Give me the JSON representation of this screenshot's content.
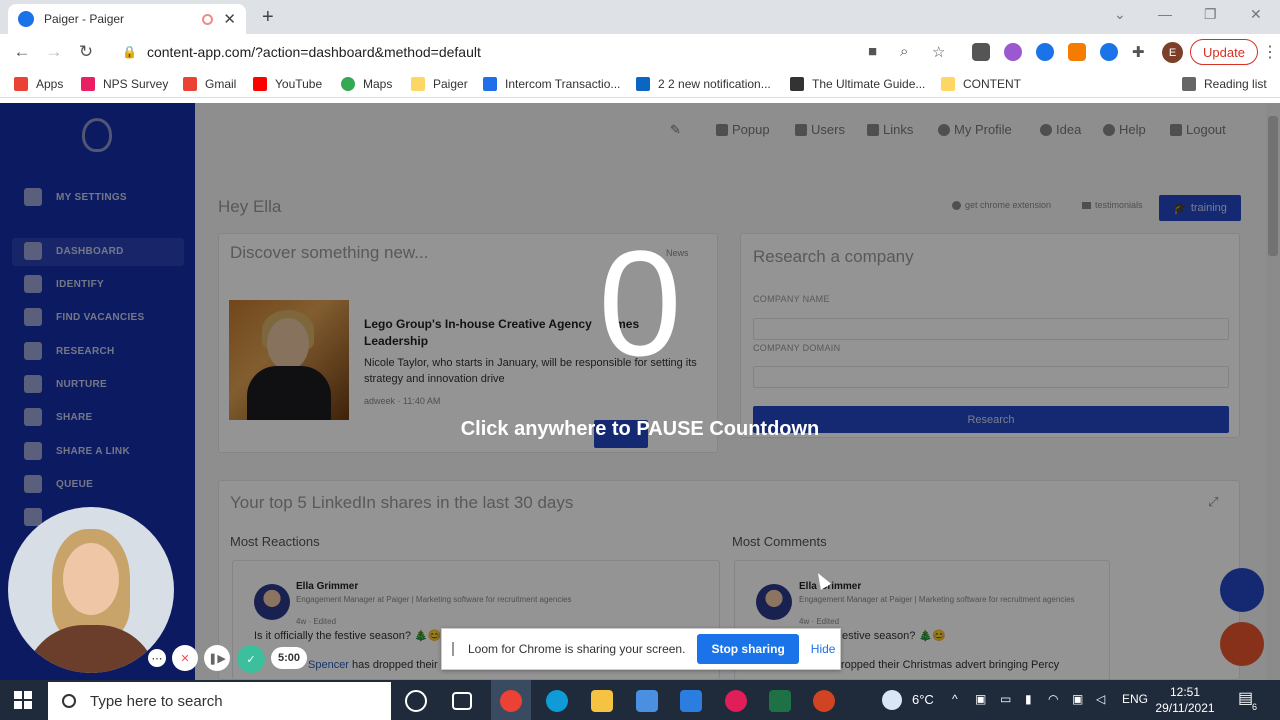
{
  "browser": {
    "tab_title": "Paiger - Paiger",
    "url": "content-app.com/?action=dashboard&method=default",
    "update_label": "Update",
    "profile_initial": "E",
    "reading_list": "Reading list"
  },
  "bookmarks": [
    {
      "label": "Apps",
      "color": "#ea4335"
    },
    {
      "label": "NPS Survey",
      "color": "#e91e63"
    },
    {
      "label": "Gmail",
      "color": "#ea4335"
    },
    {
      "label": "YouTube",
      "color": "#ff0000"
    },
    {
      "label": "Maps",
      "color": "#34a853"
    },
    {
      "label": "Paiger",
      "color": "#fdd663"
    },
    {
      "label": "Intercom Transactio...",
      "color": "#1f6feb"
    },
    {
      "label": "2 2 new notification...",
      "color": "#0a66c2"
    },
    {
      "label": "The Ultimate Guide...",
      "color": "#333333"
    },
    {
      "label": "CONTENT",
      "color": "#fdd663"
    }
  ],
  "sidebar": {
    "items": [
      {
        "label": "MY SETTINGS"
      },
      {
        "label": "DASHBOARD"
      },
      {
        "label": "IDENTIFY"
      },
      {
        "label": "FIND VACANCIES"
      },
      {
        "label": "RESEARCH"
      },
      {
        "label": "NURTURE"
      },
      {
        "label": "SHARE"
      },
      {
        "label": "SHARE A LINK"
      },
      {
        "label": "QUEUE"
      }
    ]
  },
  "topnav": [
    "Popup",
    "Users",
    "Links",
    "My Profile",
    "Idea",
    "Help",
    "Logout"
  ],
  "greeting": "Hey Ella",
  "header_links": {
    "extension": "get chrome extension",
    "testimonials": "testimonials",
    "training": "training"
  },
  "discover": {
    "title": "Discover something new...",
    "news_label": "News",
    "article_title": "Lego Group's In-house Creative Agency ...mes Leadership",
    "article_title_l1": "Lego Group's In-house Creative Agency",
    "article_title_l1b": "mes",
    "article_title_l2": "Leadership",
    "article_desc": "Nicole Taylor, who starts in January, will be responsible for setting its strategy and innovation drive",
    "source": "adweek",
    "time": "11:40 AM"
  },
  "research": {
    "title": "Research a company",
    "company_name_label": "COMPANY NAME",
    "company_domain_label": "COMPANY DOMAIN",
    "button": "Research"
  },
  "linkedin": {
    "title": "Your top 5 LinkedIn shares in the last 30 days",
    "most_reactions": "Most Reactions",
    "most_comments": "Most Comments",
    "author": "Ella Grimmer",
    "subtitle": "Engagement Manager at Paiger | Marketing software for recruitment agencies",
    "edited": "4w · Edited",
    "post_l1": "Is it officially the festive season?",
    "post_l2a": "Spencer",
    "post_l2b": "has dropped their C",
    "post_r1": "estive season?",
    "post_r2": "has dropped their Christmas advert bringing Percy"
  },
  "overlay": {
    "countdown": "0",
    "message": "Click anywhere to PAUSE Countdown"
  },
  "loom": {
    "timer": "5:00"
  },
  "sharebar": {
    "message": "Loom for Chrome is sharing your screen.",
    "stop": "Stop sharing",
    "hide": "Hide"
  },
  "taskbar": {
    "search_placeholder": "Type here to search",
    "weather": "6°C",
    "lang": "ENG",
    "time": "12:51",
    "date": "29/11/2021",
    "notif_count": "6"
  }
}
